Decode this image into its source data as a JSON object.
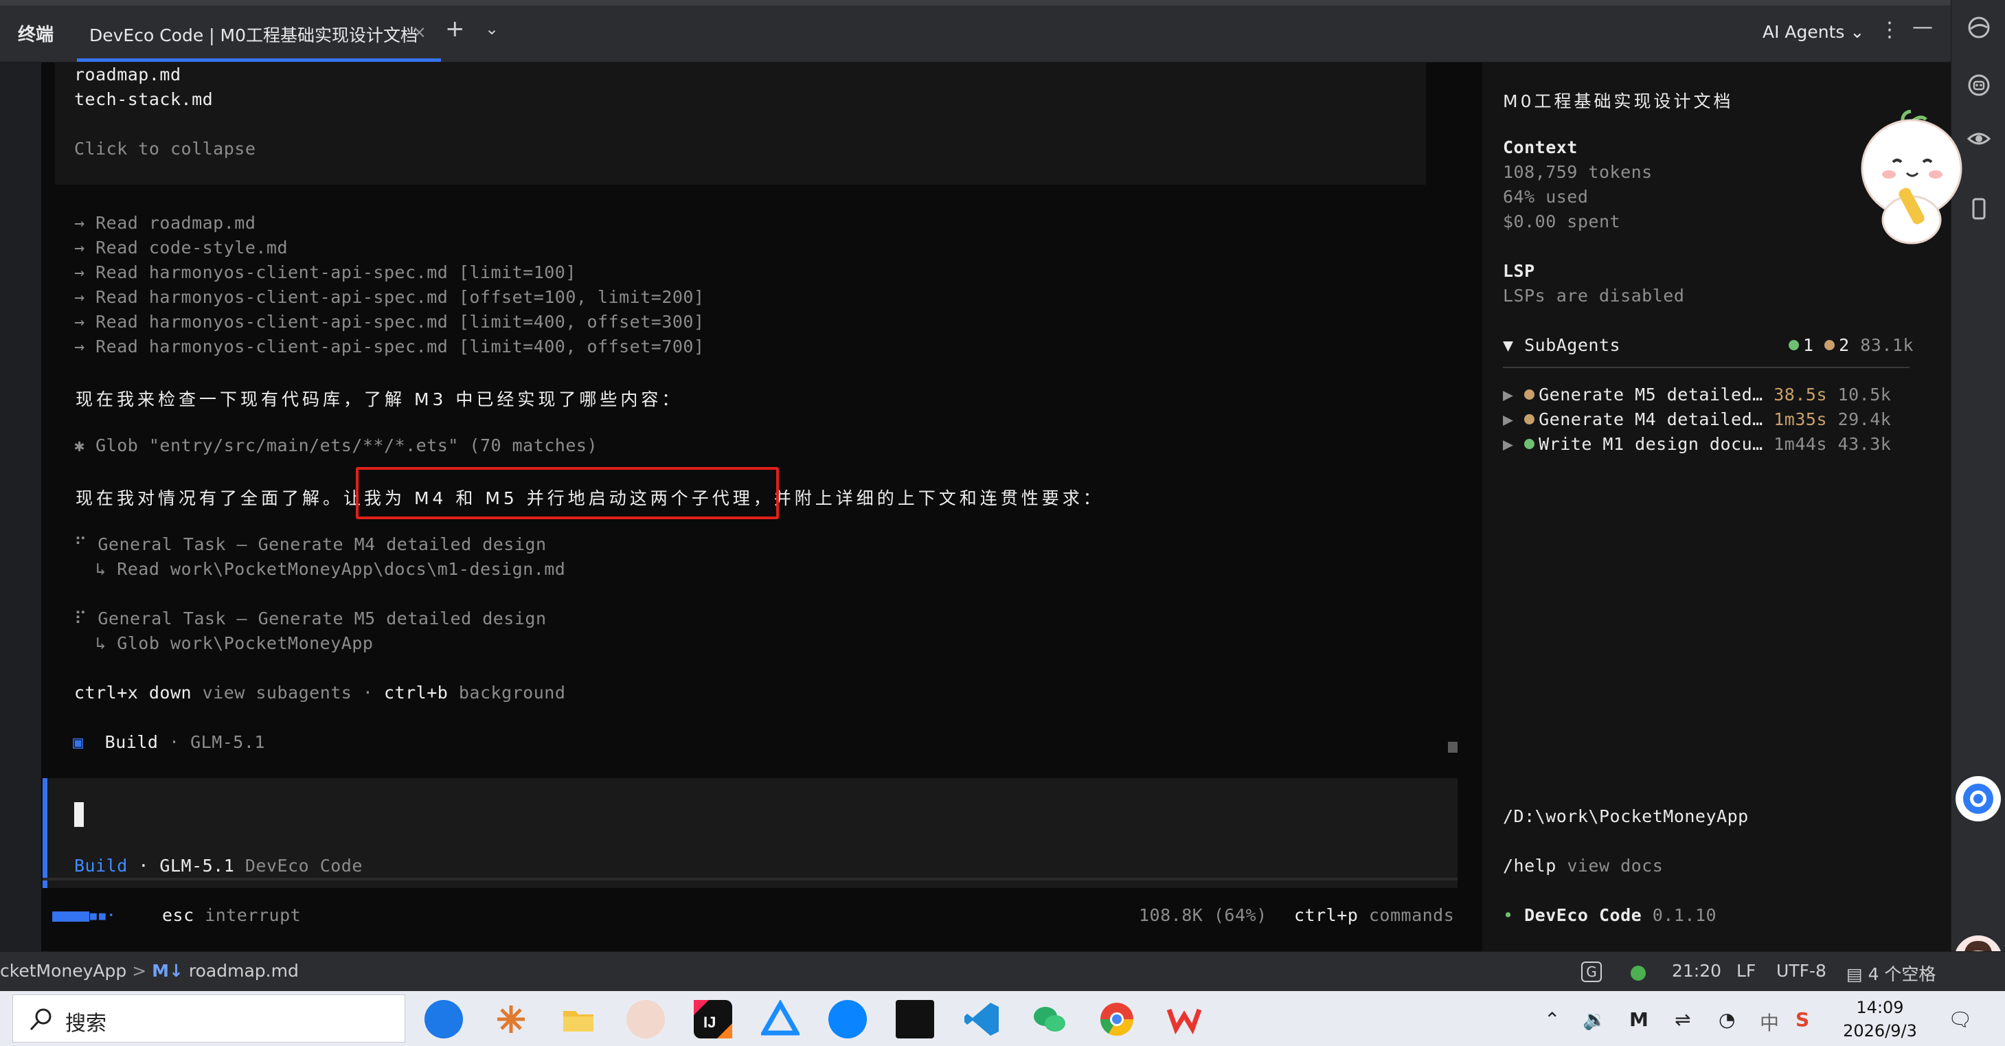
{
  "tabbar": {
    "terminal_label": "终端",
    "active_tab_title": "DevEco Code | M0工程基础实现设计文档",
    "close_symbol": "×",
    "add_symbol": "+",
    "menu_symbol": "⌄",
    "ai_agents_label": "AI Agents ⌄",
    "more_symbol": "⋮",
    "minimize_symbol": "—"
  },
  "terminal": {
    "file_lines": [
      "roadmap.md",
      "tech-stack.md"
    ],
    "collapse_hint": "Click to collapse",
    "read_lines": [
      "→ Read roadmap.md",
      "→ Read code-style.md",
      "→ Read harmonyos-client-api-spec.md [limit=100]",
      "→ Read harmonyos-client-api-spec.md [offset=100, limit=200]",
      "→ Read harmonyos-client-api-spec.md [limit=400, offset=300]",
      "→ Read harmonyos-client-api-spec.md [limit=400, offset=700]"
    ],
    "check_msg": "现在我来检查一下现有代码库，了解 M3 中已经实现了哪些内容：",
    "glob_line": "✱ Glob \"entry/src/main/ets/**/*.ets\" (70 matches)",
    "summary_pre": "现在我对情况有了全面了解。",
    "summary_highlight": "让我为 M4 和 M5 并行地启动这两个子代理",
    "summary_post": "，并附上详细的上下文和连贯性要求：",
    "task1_title": "⠋ General Task — Generate M4 detailed design",
    "task1_sub": "  ↳ Read work\\PocketMoneyApp\\docs\\m1-design.md",
    "task2_title": "⠏ General Task — Generate M5 detailed design",
    "task2_sub": "  ↳ Glob work\\PocketMoneyApp",
    "hint_key1": "ctrl+x down",
    "hint_text1": " view subagents · ",
    "hint_key2": "ctrl+b",
    "hint_text2": " background",
    "build_icon": "▣",
    "build_label": "Build",
    "build_model": " · GLM-5.1"
  },
  "input": {
    "mode": "Build",
    "model": " · GLM-5.1 ",
    "product": "DevEco Code"
  },
  "footer": {
    "spinner": "■■■■▪▪·",
    "esc_key": "esc",
    "esc_text": " interrupt",
    "tokens": "108.8K (64%)",
    "cmd_key": "ctrl+p",
    "cmd_text": " commands"
  },
  "sidebar": {
    "doc_title": "M0工程基础实现设计文档",
    "context_label": "Context",
    "tokens": "108,759 tokens",
    "used": "64% used",
    "spent": "$0.00 spent",
    "lsp_label": "LSP",
    "lsp_status": "LSPs are disabled",
    "subagents_label": "▼ SubAgents",
    "subagents_count1": "1",
    "subagents_count2": "2",
    "subagents_total": "83.1k",
    "agents": [
      {
        "name": "Generate M5 detailed…",
        "time": "38.5s",
        "tokens": "10.5k"
      },
      {
        "name": "Generate M4 detailed…",
        "time": "1m35s",
        "tokens": "29.4k"
      },
      {
        "name": "Write M1 design docu…",
        "time": "1m44s",
        "tokens": "43.3k"
      }
    ],
    "path": "/D:\\work\\PocketMoneyApp",
    "help_cmd": "/help",
    "help_text": " view docs",
    "brand_bullet": "•",
    "brand_name": "DevEco Code",
    "brand_version": " 0.1.10"
  },
  "statusbar": {
    "breadcrumb_project": "cketMoneyApp",
    "breadcrumb_sep": ">",
    "breadcrumb_file_icon": "M↓",
    "breadcrumb_file": "roadmap.md",
    "position": "21:20",
    "line_ending": "LF",
    "encoding": "UTF-8",
    "indent": "4 个空格"
  },
  "taskbar": {
    "search_label": "搜索",
    "time": "14:09",
    "date": "2026/9/3",
    "ime": "中"
  },
  "colors": {
    "accent_blue": "#3574f0",
    "highlight_red": "#e0201a",
    "agent_running": "#c9a06a",
    "agent_done": "#6fbf73"
  }
}
